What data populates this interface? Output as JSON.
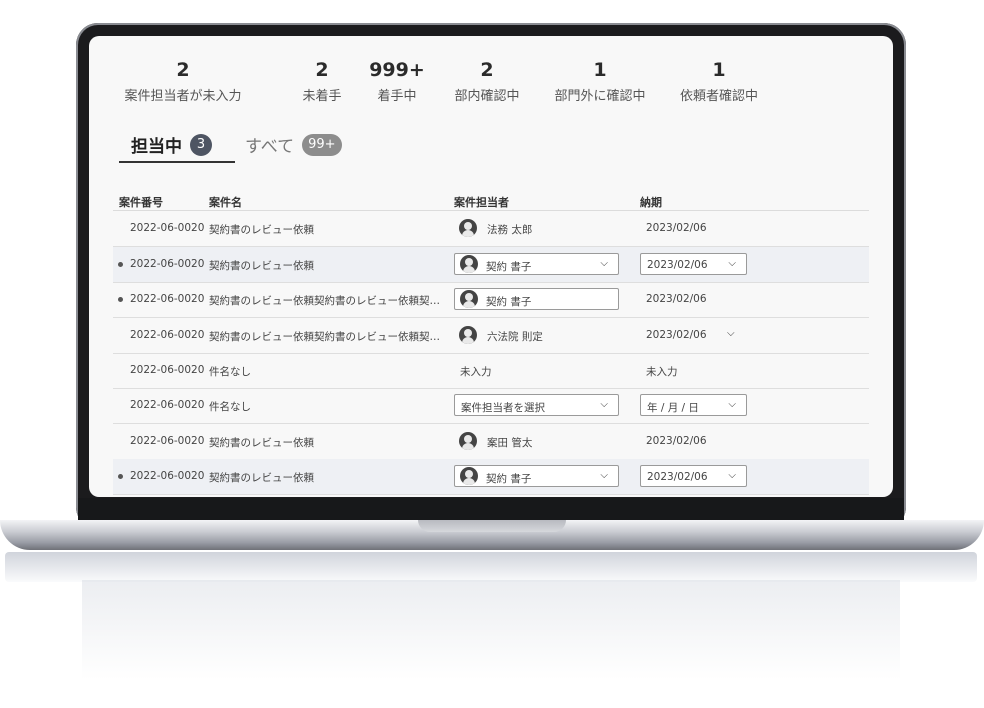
{
  "stats": [
    {
      "value": "2",
      "label": "案件担当者が未入力"
    },
    {
      "value": "2",
      "label": "未着手"
    },
    {
      "value": "999+",
      "label": "着手中"
    },
    {
      "value": "2",
      "label": "部内確認中"
    },
    {
      "value": "1",
      "label": "部門外に確認中"
    },
    {
      "value": "1",
      "label": "依頼者確認中"
    }
  ],
  "tabs": [
    {
      "label": "担当中",
      "badge": "3"
    },
    {
      "label": "すべて",
      "badge": "99+"
    }
  ],
  "table": {
    "headers": [
      "案件番号",
      "案件名",
      "案件担当者",
      "納期"
    ],
    "rows": [
      {
        "id": "2022-06-0020",
        "name": "契約書のレビュー依頼",
        "assignee": "法務 太郎",
        "due": "2023/02/06"
      },
      {
        "id": "2022-06-0020",
        "name": "契約書のレビュー依頼",
        "assignee": "契約 書子",
        "due": "2023/02/06"
      },
      {
        "id": "2022-06-0020",
        "name": "契約書のレビュー依頼契約書のレビュー依頼契…",
        "assignee": "契約 書子",
        "due": "2023/02/06"
      },
      {
        "id": "2022-06-0020",
        "name": "契約書のレビュー依頼契約書のレビュー依頼契…",
        "assignee": "六法院 則定",
        "due": "2023/02/06"
      },
      {
        "id": "2022-06-0020",
        "name": "件名なし",
        "assignee": "未入力",
        "due": "未入力"
      },
      {
        "id": "2022-06-0020",
        "name": "件名なし",
        "assignee": "案件担当者を選択",
        "due": "年 / 月 / 日"
      },
      {
        "id": "2022-06-0020",
        "name": "契約書のレビュー依頼",
        "assignee": "案田 管太",
        "due": "2023/02/06"
      },
      {
        "id": "2022-06-0020",
        "name": "契約書のレビュー依頼",
        "assignee": "契約 書子",
        "due": "2023/02/06"
      }
    ]
  },
  "icons": {
    "chevron": "chevron-down-icon",
    "avatar": "user-avatar-icon"
  }
}
